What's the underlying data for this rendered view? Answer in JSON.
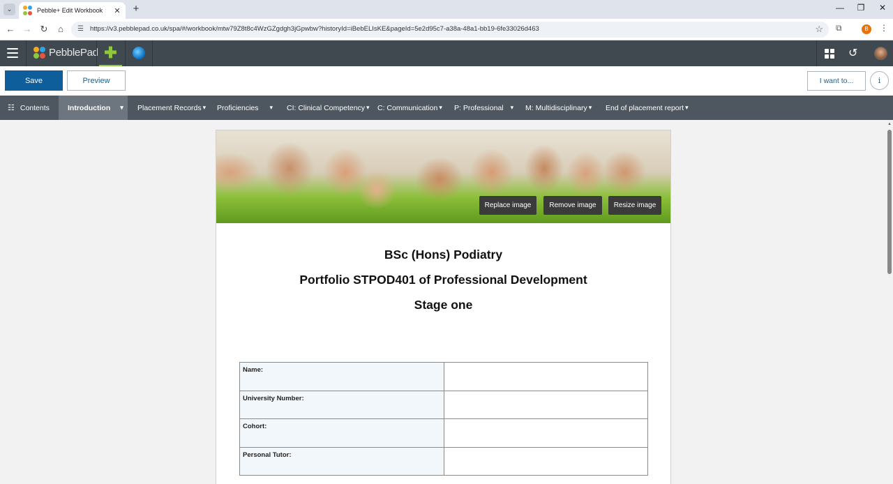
{
  "browser": {
    "tab_title": "Pebble+ Edit Workbook",
    "url": "https://v3.pebblepad.co.uk/spa/#/workbook/mtw79Z8t8c4WzGZgdgh3jGpwbw?historyId=iBebELIsKE&pageId=5e2d95c7-a38a-48a1-bb19-6fe33026d463",
    "profile_initial": "B",
    "new_tab_symbol": "+",
    "close_tab_symbol": "✕"
  },
  "app": {
    "name": "PebblePad",
    "logo_colors": [
      "#f4a81d",
      "#2fa3e6",
      "#8fc73e",
      "#e8543e"
    ]
  },
  "actions": {
    "save_label": "Save",
    "preview_label": "Preview",
    "iwant_label": "I want to...",
    "info_label": "i"
  },
  "workbook_nav": {
    "contents_label": "Contents",
    "items": [
      {
        "label": "Introduction",
        "active": true
      },
      {
        "label": "Placement Records"
      },
      {
        "label": "Proficiencies"
      },
      {
        "label": "CI: Clinical Competency"
      },
      {
        "label": "C: Communication"
      },
      {
        "label": "P: Professional"
      },
      {
        "label": "M: Multidisciplinary"
      },
      {
        "label": "End of placement report"
      }
    ]
  },
  "banner": {
    "replace_label": "Replace image",
    "remove_label": "Remove image",
    "resize_label": "Resize image"
  },
  "content": {
    "title_line1": "BSc (Hons) Podiatry",
    "title_line2": "Portfolio STPOD401 of Professional Development",
    "title_line3": "Stage one",
    "table_rows": [
      {
        "label": "Name:",
        "value": ""
      },
      {
        "label": "University Number:",
        "value": ""
      },
      {
        "label": "Cohort:",
        "value": ""
      },
      {
        "label": "Personal Tutor:",
        "value": ""
      }
    ]
  },
  "colors": {
    "save_blue": "#0f5e9c",
    "topbar": "#404850",
    "wbnav": "#4e575f",
    "active_tab": "#6d767e",
    "accent_green": "#8fc73e"
  }
}
